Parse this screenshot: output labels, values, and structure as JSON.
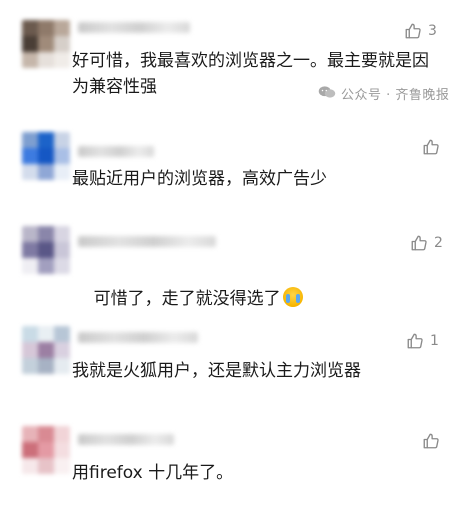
{
  "watermark": {
    "text": "公众号 · 齐鲁晚报",
    "icon": "wechat-icon"
  },
  "comments": [
    {
      "text": "好可惜，我最喜欢的浏览器之一。最主要就是因为兼容性强",
      "likes": "3",
      "avatar_colors": [
        "#6b5a4e",
        "#8f7a6a",
        "#b9a89a",
        "#4a3e36",
        "#a08b7a",
        "#d6cfc9",
        "#c5b6aa",
        "#e6e0db",
        "#f0ece8"
      ]
    },
    {
      "text": "最贴近用户的浏览器，高效广告少",
      "likes": "",
      "avatar_colors": [
        "#7e9fd0",
        "#1c63c9",
        "#c8d3e6",
        "#3d7be0",
        "#1557c4",
        "#a9bfe6",
        "#d3dcec",
        "#8fa7d6",
        "#e8eef7"
      ]
    },
    {
      "text": "可惜了，走了就没得选了",
      "likes": "2",
      "avatar_colors": [
        "#b9b6c9",
        "#8a86aa",
        "#d8d5e2",
        "#7f7aa3",
        "#5a5787",
        "#c9c6d8",
        "#efeef3",
        "#a29fbf",
        "#dcdae6"
      ]
    },
    {
      "text": "我就是火狐用户，还是默认主力浏览器",
      "likes": "1",
      "avatar_colors": [
        "#c9dbe6",
        "#e9eff3",
        "#b7c6d6",
        "#d6c7d8",
        "#9c7fa3",
        "#d9d0e0",
        "#c3d0db",
        "#a7b2c4",
        "#e5ebf0"
      ]
    },
    {
      "text": "用firefox 十几年了。",
      "likes": "",
      "avatar_colors": [
        "#e7b3b8",
        "#d98a93",
        "#f1d4d7",
        "#cc6f7a",
        "#e49aa4",
        "#f4dde0",
        "#f6e8ea",
        "#e7c3c8",
        "#f9f0f1"
      ]
    }
  ],
  "colors": {
    "text": "#1a1a1a",
    "meta": "#8a8a8a",
    "name_blur": "#d0d0d0"
  }
}
